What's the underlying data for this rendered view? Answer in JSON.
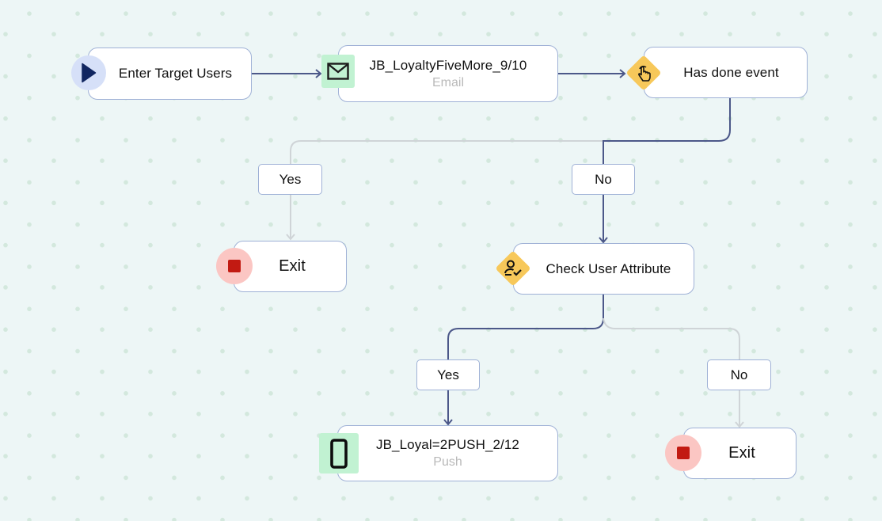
{
  "canvas": {
    "background": "#edf6f6",
    "edge_active_color": "#4c5889",
    "edge_inactive_color": "#cfd4d7"
  },
  "nodes": {
    "start": {
      "title": "Enter Target Users",
      "icon": "play-icon"
    },
    "email": {
      "title": "JB_LoyaltyFiveMore_9/10",
      "subtitle": "Email",
      "icon": "envelope-icon"
    },
    "has_done_event": {
      "title": "Has done event",
      "icon": "tap-hand-icon"
    },
    "exit_1": {
      "title": "Exit",
      "icon": "stop-icon"
    },
    "check_user_attribute": {
      "title": "Check User Attribute",
      "icon": "user-check-icon"
    },
    "push": {
      "title": "JB_Loyal=2PUSH_2/12",
      "subtitle": "Push",
      "icon": "mobile-phone-icon"
    },
    "exit_2": {
      "title": "Exit",
      "icon": "stop-icon"
    }
  },
  "branches": {
    "event_yes": "Yes",
    "event_no": "No",
    "attr_yes": "Yes",
    "attr_no": "No"
  }
}
